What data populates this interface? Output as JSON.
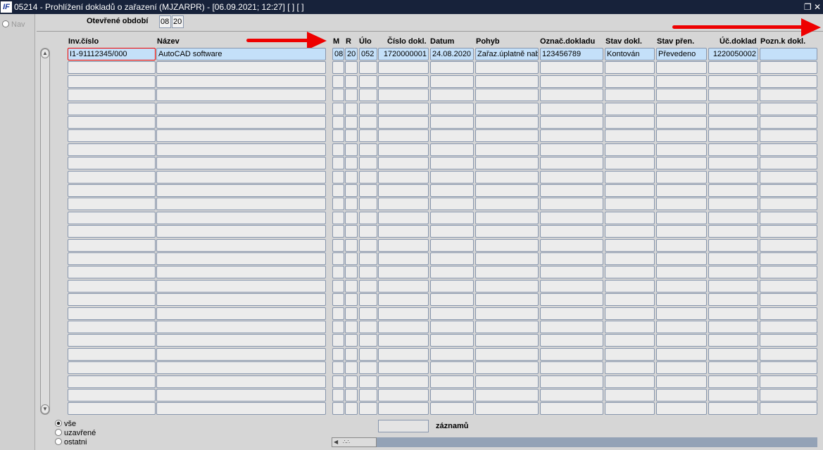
{
  "window": {
    "logo": "IF",
    "title": "05214 - Prohlížení dokladů o zařazení (MJZARPR) - [06.09.2021; 12:27]  [ ]  [ ]",
    "restore_icon": "restore-icon",
    "close_icon": "close-icon"
  },
  "nav": {
    "label": "Nav"
  },
  "period": {
    "label": "Otevřené období",
    "month": "08",
    "year": "20"
  },
  "columns": [
    "Inv.číslo",
    "Název",
    "M",
    "R",
    "Úlo",
    "Číslo dokl.",
    "Datum",
    "Pohyb",
    "Označ.dokladu",
    "Stav dokl.",
    "Stav přen.",
    "Úč.doklad",
    "Pozn.k dokl."
  ],
  "rows": [
    [
      "I1-91112345/000",
      "AutoCAD software",
      "08",
      "20",
      "052",
      "1720000001",
      "24.08.2020",
      "Zařaz.úplatně nab",
      "123456789",
      "Kontován",
      "Převedeno",
      "1220050002",
      ""
    ]
  ],
  "row_count": 27,
  "filters": [
    {
      "label": "vše",
      "selected": true
    },
    {
      "label": "uzavřené",
      "selected": false
    },
    {
      "label": "ostatni",
      "selected": false
    }
  ],
  "records": {
    "value": "",
    "label": "záznamů"
  },
  "colors": {
    "titlebar": "#17223a",
    "active_row": "#c4e0f9",
    "arrow": "#ee0000"
  }
}
